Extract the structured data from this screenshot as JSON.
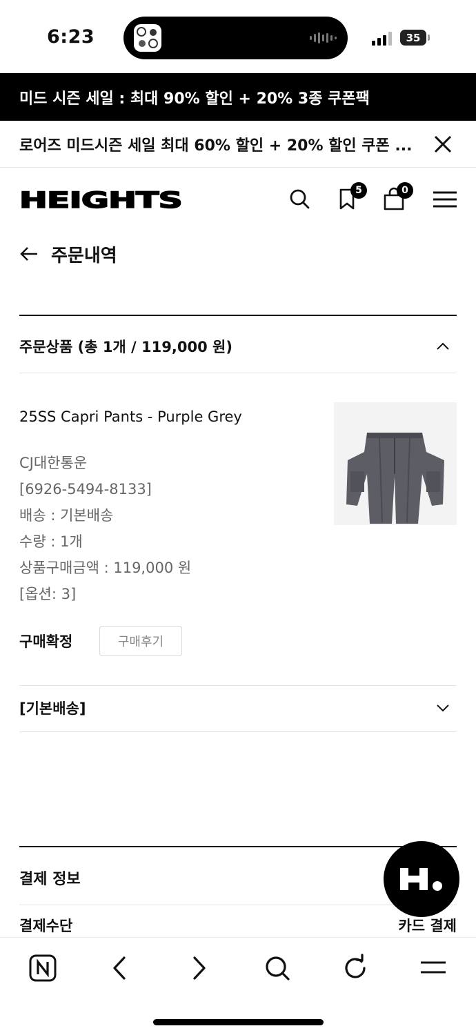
{
  "status_bar": {
    "time": "6:23",
    "battery": "35"
  },
  "banners": {
    "promo_main": "미드 시즌 세일 : 최대 90% 할인 + 20% 3종 쿠폰팩",
    "promo_sub": "로어즈 미드시즌 세일 최대 60% 할인 + 20% 할인 쿠폰 ..."
  },
  "header": {
    "logo": "HEIGHTS",
    "wishlist_count": "5",
    "cart_count": "0"
  },
  "page": {
    "title": "주문내역"
  },
  "order_items": {
    "heading": "주문상품 (총 1개 / 119,000 원)",
    "product": {
      "name": "25SS Capri Pants - Purple Grey",
      "courier": "CJ대한통운",
      "tracking": "[6926-5494-8133]",
      "shipping": "배송 : 기본배송",
      "quantity": "수량 : 1개",
      "amount": "상품구매금액 : 119,000 원",
      "option": "[옵션: 3]"
    },
    "status": "구매확정",
    "review_label": "구매후기"
  },
  "shipping_section": {
    "heading": "[기본배송]"
  },
  "payment": {
    "title": "결제 정보",
    "method_label": "결제수단",
    "method_value": "카드 결제"
  },
  "colors": {
    "accent": "#000000",
    "muted": "#666666",
    "divider": "#e3e3e3"
  },
  "icons": [
    "close-icon",
    "search-icon",
    "bookmark-icon",
    "cart-icon",
    "menu-icon",
    "back-arrow-icon",
    "chevron-up-icon",
    "chevron-down-icon",
    "naver-icon",
    "browser-back-icon",
    "browser-forward-icon",
    "browser-search-icon",
    "refresh-icon",
    "browser-menu-icon"
  ]
}
